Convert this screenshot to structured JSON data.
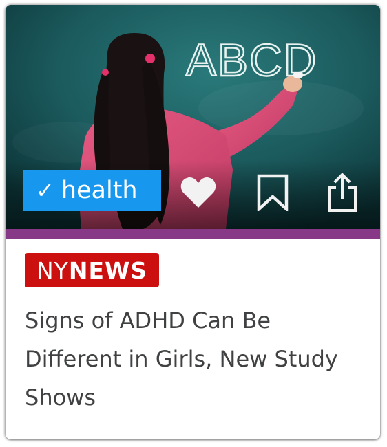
{
  "card": {
    "category": {
      "check_glyph": "✓",
      "label": "health",
      "color": "#1797ee"
    },
    "actions": {
      "like_icon": "heart-icon",
      "save_icon": "bookmark-icon",
      "share_icon": "share-icon"
    },
    "chalkboard_text": "ABCD",
    "accent_color": "#873886",
    "source": {
      "prefix": "NY",
      "name": "NEWS",
      "color": "#cc1010"
    },
    "headline": "Signs of ADHD Can Be Different in Girls, New Study Shows"
  }
}
